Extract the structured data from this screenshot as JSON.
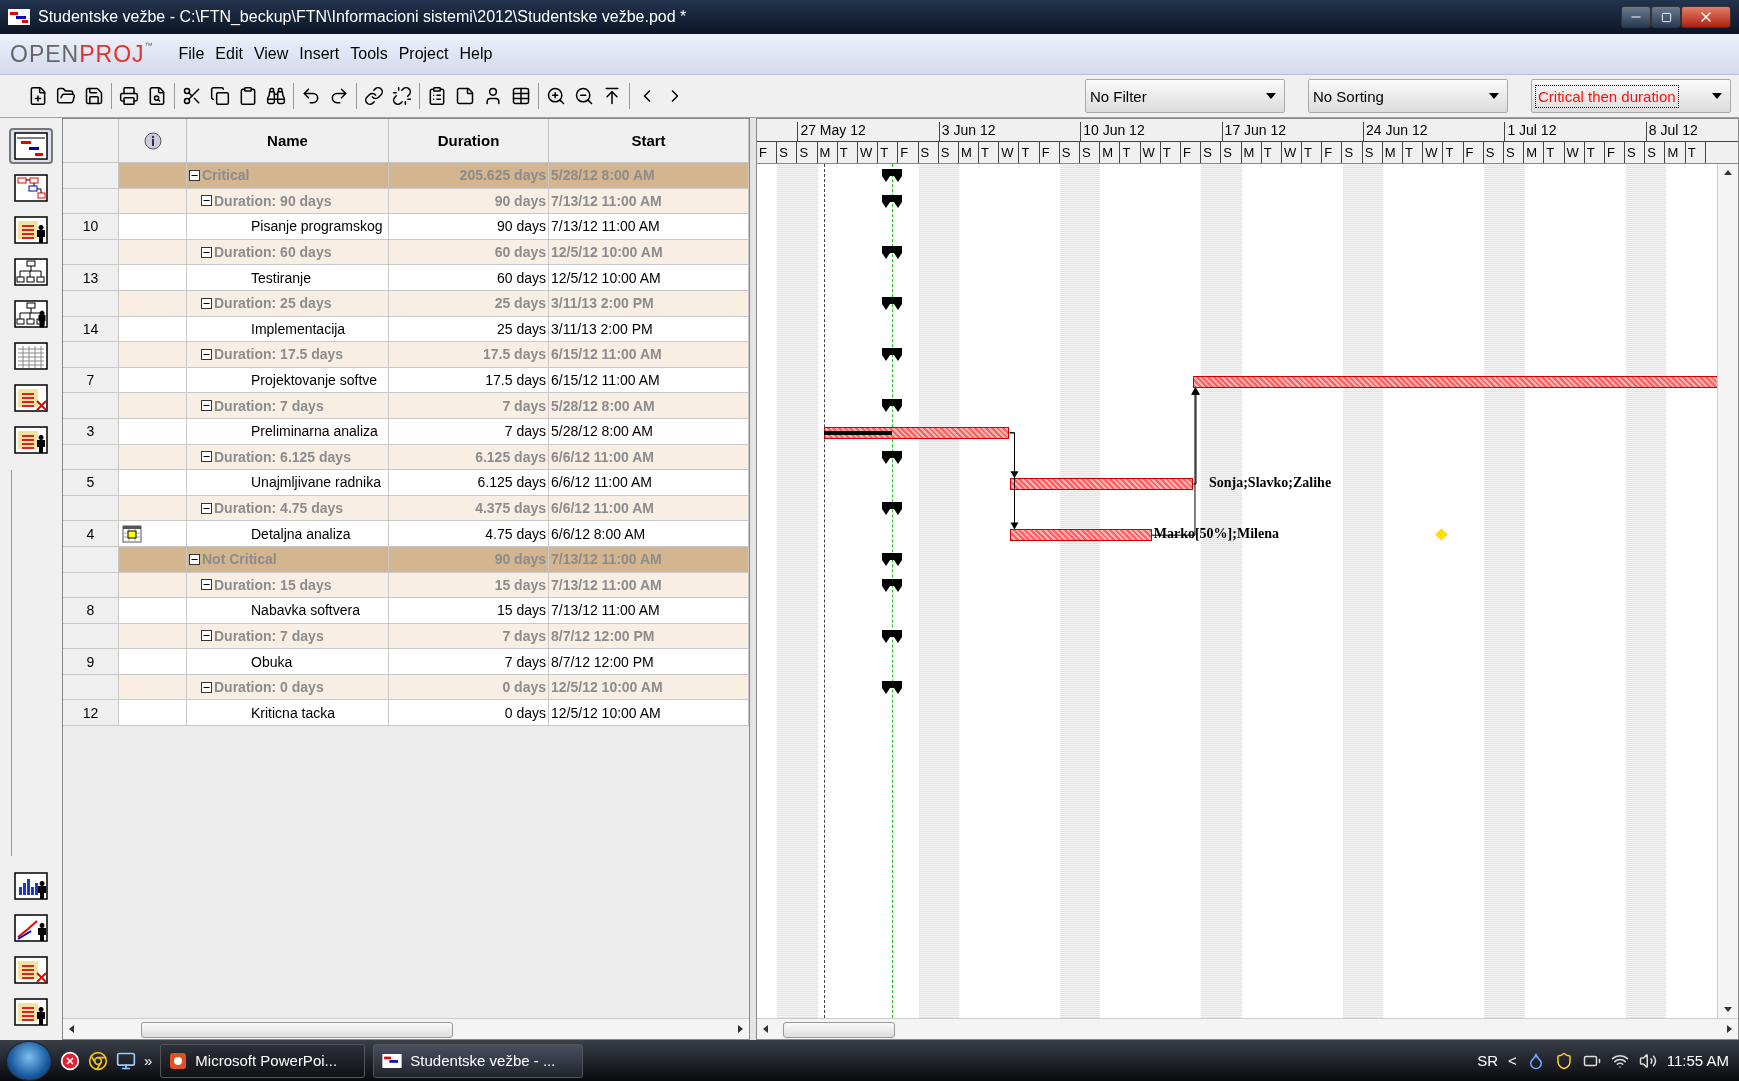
{
  "window": {
    "title": "Studentske vežbe - C:\\FTN_beckup\\FTN\\Informacioni sistemi\\2012\\Studentske vežbe.pod *"
  },
  "logo": {
    "open": "OPEN",
    "proj": "PROJ",
    "mark": "™"
  },
  "menu": [
    "File",
    "Edit",
    "View",
    "Insert",
    "Tools",
    "Project",
    "Help"
  ],
  "dropdowns": [
    {
      "value": "No Filter",
      "highlighted": false
    },
    {
      "value": "No Sorting",
      "highlighted": false
    },
    {
      "value": "Critical then duration",
      "highlighted": true
    }
  ],
  "views": [
    {
      "kind": "gantt",
      "selected": true
    },
    {
      "kind": "network",
      "selected": false
    },
    {
      "kind": "resources",
      "selected": false
    },
    {
      "kind": "wbs",
      "selected": false
    },
    {
      "kind": "rbs",
      "selected": false
    },
    {
      "kind": "sheet",
      "selected": false
    },
    {
      "kind": "task-usage",
      "selected": false
    },
    {
      "kind": "resource-usage",
      "selected": false
    }
  ],
  "bottom_views": [
    {
      "kind": "histogram",
      "selected": false
    },
    {
      "kind": "charts",
      "selected": false
    },
    {
      "kind": "task-usage",
      "selected": false
    },
    {
      "kind": "resource-usage",
      "selected": false
    }
  ],
  "table": {
    "columns": [
      "Name",
      "Duration",
      "Start"
    ]
  },
  "groups": [
    {
      "kind": "group",
      "label": "Critical",
      "duration": "205.625 days",
      "start": "5/28/12 8:00 AM",
      "expanded": true,
      "children": [
        {
          "kind": "group",
          "label": "Duration: 90 days",
          "duration": "90 days",
          "start": "7/13/12 11:00 AM",
          "expanded": true,
          "children": [
            {
              "kind": "task",
              "id": "10",
              "name": "Pisanje programskog",
              "duration": "90 days",
              "start": "7/13/12 11:00 AM"
            }
          ]
        },
        {
          "kind": "group",
          "label": "Duration: 60 days",
          "duration": "60 days",
          "start": "12/5/12 10:00 AM",
          "expanded": true,
          "children": [
            {
              "kind": "task",
              "id": "13",
              "name": "Testiranje",
              "duration": "60 days",
              "start": "12/5/12 10:00 AM"
            }
          ]
        },
        {
          "kind": "group",
          "label": "Duration: 25 days",
          "duration": "25 days",
          "start": "3/11/13 2:00 PM",
          "expanded": true,
          "children": [
            {
              "kind": "task",
              "id": "14",
              "name": "Implementacija",
              "duration": "25 days",
              "start": "3/11/13 2:00 PM"
            }
          ]
        },
        {
          "kind": "group",
          "label": "Duration: 17.5 days",
          "duration": "17.5 days",
          "start": "6/15/12 11:00 AM",
          "expanded": true,
          "children": [
            {
              "kind": "task",
              "id": "7",
              "name": "Projektovanje softve",
              "duration": "17.5 days",
              "start": "6/15/12 11:00 AM",
              "bar": {
                "critical": true
              }
            }
          ]
        },
        {
          "kind": "group",
          "label": "Duration: 7 days",
          "duration": "7 days",
          "start": "5/28/12 8:00 AM",
          "expanded": true,
          "children": [
            {
              "kind": "task",
              "id": "3",
              "name": "Preliminarna analiza",
              "duration": "7 days",
              "start": "5/28/12 8:00 AM",
              "bar": {
                "critical": true,
                "level": 0.37
              }
            }
          ]
        },
        {
          "kind": "group",
          "label": "Duration: 6.125 days",
          "duration": "6.125 days",
          "start": "6/6/12 11:00 AM",
          "expanded": true,
          "children": [
            {
              "kind": "task",
              "id": "5",
              "name": "Unajmljivane radnika",
              "duration": "6.125 days",
              "start": "6/6/12 11:00 AM",
              "bar": {
                "critical": true,
                "resources": "Sonja;Slavko;Zalihe"
              }
            }
          ]
        },
        {
          "kind": "group",
          "label": "Duration: 4.75 days",
          "duration": "4.375 days",
          "start": "6/6/12 11:00 AM",
          "expanded": true,
          "children": [
            {
              "kind": "task",
              "id": "4",
              "name": "Detaljna analiza",
              "duration": "4.75 days",
              "start": "6/6/12 8:00 AM",
              "calendar_indicator": true,
              "diamond": true,
              "bar": {
                "critical": true,
                "resources": "Marko[50%];Milena"
              }
            }
          ]
        }
      ]
    },
    {
      "kind": "group",
      "label": "Not Critical",
      "duration": "90 days",
      "start": "7/13/12 11:00 AM",
      "expanded": true,
      "children": [
        {
          "kind": "group",
          "label": "Duration: 15 days",
          "duration": "15 days",
          "start": "7/13/12 11:00 AM",
          "expanded": true,
          "children": [
            {
              "kind": "task",
              "id": "8",
              "name": "Nabavka softvera",
              "duration": "15 days",
              "start": "7/13/12 11:00 AM"
            }
          ]
        },
        {
          "kind": "group",
          "label": "Duration: 7 days",
          "duration": "7 days",
          "start": "8/7/12 12:00 PM",
          "expanded": true,
          "children": [
            {
              "kind": "task",
              "id": "9",
              "name": "Obuka",
              "duration": "7 days",
              "start": "8/7/12 12:00 PM"
            }
          ]
        },
        {
          "kind": "group",
          "label": "Duration: 0 days",
          "duration": "0 days",
          "start": "12/5/12 10:00 AM",
          "expanded": true,
          "children": [
            {
              "kind": "task",
              "id": "12",
              "name": "Kriticna tacka",
              "duration": "0 days",
              "start": "12/5/12 10:00 AM"
            }
          ]
        }
      ]
    }
  ],
  "gantt": {
    "weeks": [
      "27 May 12",
      "3 Jun 12",
      "10 Jun 12",
      "17 Jun 12",
      "24 Jun 12",
      "1 Jul 12",
      "8 Jul 12"
    ],
    "day_letters": [
      "F",
      "S",
      "S",
      "M",
      "T",
      "W",
      "T",
      "F",
      "S",
      "S",
      "M",
      "T",
      "W",
      "T",
      "F",
      "S",
      "S",
      "M",
      "T",
      "W",
      "T",
      "F",
      "S",
      "S",
      "M",
      "T",
      "W",
      "T",
      "F",
      "S",
      "S",
      "M",
      "T",
      "W",
      "T",
      "F",
      "S",
      "S",
      "M",
      "T",
      "W",
      "T",
      "F",
      "S",
      "S",
      "M",
      "T"
    ]
  },
  "taskbar": {
    "overflow": "»",
    "buttons": [
      {
        "label": "Microsoft PowerPoi...",
        "kind": "powerpoint",
        "selected": false
      },
      {
        "label": "Studentske vežbe - ...",
        "kind": "openproj",
        "selected": true
      }
    ],
    "language": "SR",
    "tray_toggle": "<",
    "clock": "11:55 AM"
  }
}
